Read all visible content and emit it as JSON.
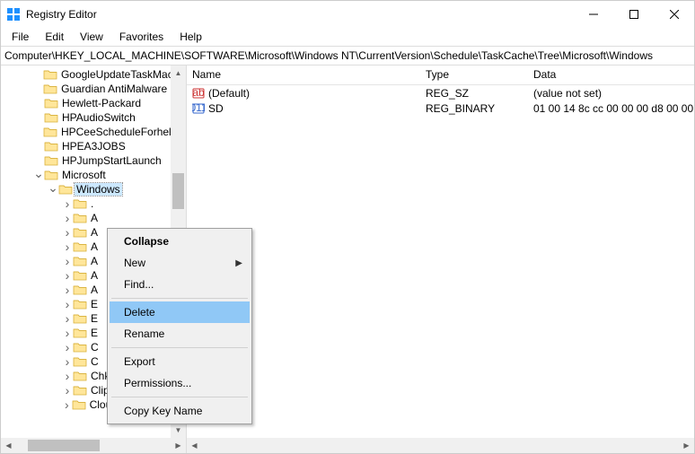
{
  "window": {
    "title": "Registry Editor"
  },
  "menu": {
    "file": "File",
    "edit": "Edit",
    "view": "View",
    "favorites": "Favorites",
    "help": "Help"
  },
  "address": {
    "path": "Computer\\HKEY_LOCAL_MACHINE\\SOFTWARE\\Microsoft\\Windows NT\\CurrentVersion\\Schedule\\TaskCache\\Tree\\Microsoft\\Windows"
  },
  "tree": {
    "items": [
      {
        "indent": 36,
        "twisty": "",
        "label": "GoogleUpdateTaskMach"
      },
      {
        "indent": 36,
        "twisty": "",
        "label": "Guardian AntiMalware S"
      },
      {
        "indent": 36,
        "twisty": "",
        "label": "Hewlett-Packard"
      },
      {
        "indent": 36,
        "twisty": "",
        "label": "HPAudioSwitch"
      },
      {
        "indent": 36,
        "twisty": "",
        "label": "HPCeeScheduleForhellc"
      },
      {
        "indent": 36,
        "twisty": "",
        "label": "HPEA3JOBS"
      },
      {
        "indent": 36,
        "twisty": "",
        "label": "HPJumpStartLaunch"
      },
      {
        "indent": 36,
        "twisty": "v",
        "label": "Microsoft"
      },
      {
        "indent": 52,
        "twisty": "v",
        "label": "Windows",
        "selected": true
      },
      {
        "indent": 68,
        "twisty": ">",
        "label": "."
      },
      {
        "indent": 68,
        "twisty": ">",
        "label": "A"
      },
      {
        "indent": 68,
        "twisty": ">",
        "label": "A"
      },
      {
        "indent": 68,
        "twisty": ">",
        "label": "A"
      },
      {
        "indent": 68,
        "twisty": ">",
        "label": "A"
      },
      {
        "indent": 68,
        "twisty": ">",
        "label": "A"
      },
      {
        "indent": 68,
        "twisty": ">",
        "label": "A"
      },
      {
        "indent": 68,
        "twisty": ">",
        "label": "E"
      },
      {
        "indent": 68,
        "twisty": ">",
        "label": "E"
      },
      {
        "indent": 68,
        "twisty": ">",
        "label": "E"
      },
      {
        "indent": 68,
        "twisty": ">",
        "label": "C"
      },
      {
        "indent": 68,
        "twisty": ">",
        "label": "C"
      },
      {
        "indent": 68,
        "twisty": ">",
        "label": "Chkdsk"
      },
      {
        "indent": 68,
        "twisty": ">",
        "label": "Clip"
      },
      {
        "indent": 68,
        "twisty": ">",
        "label": "CloudExperienceH"
      }
    ]
  },
  "list": {
    "columns": {
      "name": "Name",
      "type": "Type",
      "data": "Data"
    },
    "rows": [
      {
        "icon": "string",
        "name": "(Default)",
        "type": "REG_SZ",
        "data": "(value not set)"
      },
      {
        "icon": "binary",
        "name": "SD",
        "type": "REG_BINARY",
        "data": "01 00 14 8c cc 00 00 00 d8 00 00"
      }
    ]
  },
  "ctx": {
    "collapse": "Collapse",
    "new": "New",
    "find": "Find...",
    "delete": "Delete",
    "rename": "Rename",
    "export": "Export",
    "permissions": "Permissions...",
    "copy": "Copy Key Name"
  }
}
